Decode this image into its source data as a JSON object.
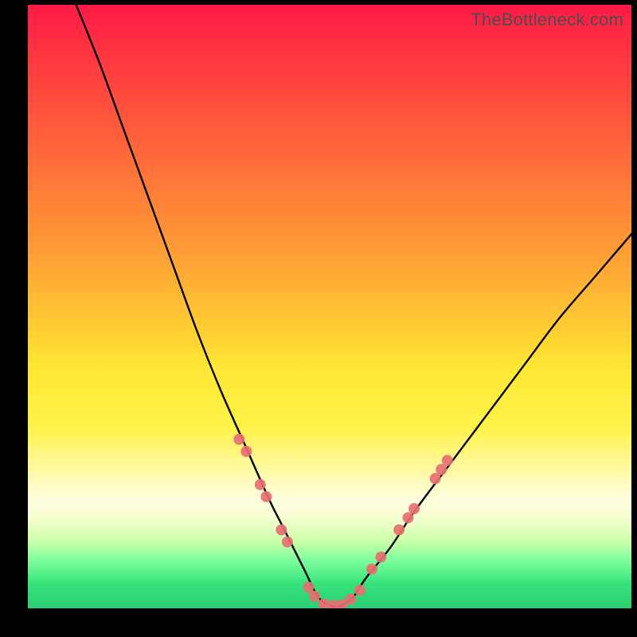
{
  "watermark": "TheBottleneck.com",
  "chart_data": {
    "type": "line",
    "title": "",
    "xlabel": "",
    "ylabel": "",
    "xlim": [
      0,
      100
    ],
    "ylim": [
      0,
      100
    ],
    "series": [
      {
        "name": "curve",
        "color": "#000000",
        "x": [
          8,
          12,
          16,
          20,
          24,
          28,
          32,
          36,
          40,
          42,
          44,
          46,
          48,
          50,
          52,
          54,
          56,
          60,
          64,
          70,
          76,
          82,
          88,
          94,
          100
        ],
        "y": [
          100,
          90,
          79,
          68,
          57,
          46,
          36,
          27,
          18,
          14,
          10,
          6,
          2,
          0.5,
          0.5,
          2,
          5,
          10,
          16,
          24,
          32,
          40,
          48,
          55,
          62
        ]
      }
    ],
    "markers": {
      "name": "highlight-dots",
      "color": "#e76f71",
      "radius_px": 7,
      "points": [
        {
          "x": 35.0,
          "y": 28.0
        },
        {
          "x": 36.2,
          "y": 26.0
        },
        {
          "x": 38.5,
          "y": 20.5
        },
        {
          "x": 39.5,
          "y": 18.5
        },
        {
          "x": 42.0,
          "y": 13.0
        },
        {
          "x": 43.0,
          "y": 11.0
        },
        {
          "x": 46.5,
          "y": 3.5
        },
        {
          "x": 47.5,
          "y": 2.0
        },
        {
          "x": 49.0,
          "y": 0.7
        },
        {
          "x": 50.5,
          "y": 0.5
        },
        {
          "x": 52.0,
          "y": 0.6
        },
        {
          "x": 53.5,
          "y": 1.5
        },
        {
          "x": 55.0,
          "y": 3.0
        },
        {
          "x": 57.0,
          "y": 6.5
        },
        {
          "x": 58.5,
          "y": 8.5
        },
        {
          "x": 61.5,
          "y": 13.0
        },
        {
          "x": 63.0,
          "y": 15.0
        },
        {
          "x": 64.0,
          "y": 16.5
        },
        {
          "x": 67.5,
          "y": 21.5
        },
        {
          "x": 68.5,
          "y": 23.0
        },
        {
          "x": 69.5,
          "y": 24.5
        }
      ]
    }
  }
}
